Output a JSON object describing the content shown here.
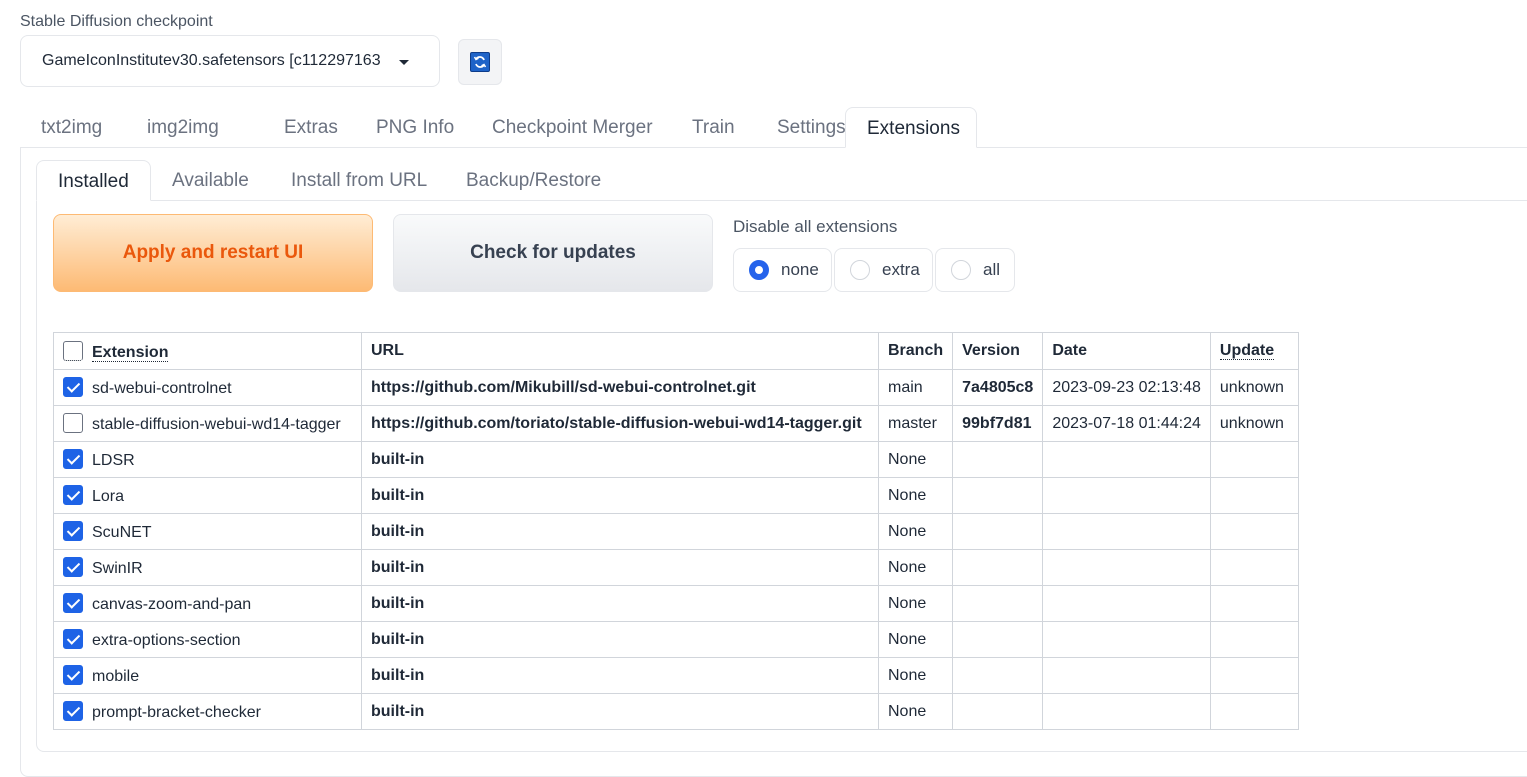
{
  "checkpoint": {
    "label": "Stable Diffusion checkpoint",
    "value": "GameIconInstitutev30.safetensors [c112297163"
  },
  "top_tabs": [
    "txt2img",
    "img2img",
    "Extras",
    "PNG Info",
    "Checkpoint Merger",
    "Train",
    "Settings",
    "Extensions"
  ],
  "top_tab_active": "Extensions",
  "inner_tabs": [
    "Installed",
    "Available",
    "Install from URL",
    "Backup/Restore"
  ],
  "inner_tab_active": "Installed",
  "buttons": {
    "apply": "Apply and restart UI",
    "check": "Check for updates"
  },
  "disable": {
    "label": "Disable all extensions",
    "options": [
      "none",
      "extra",
      "all"
    ],
    "selected": "none"
  },
  "table": {
    "headers": [
      "Extension",
      "URL",
      "Branch",
      "Version",
      "Date",
      "Update"
    ],
    "header_checked": false,
    "rows": [
      {
        "checked": true,
        "name": "sd-webui-controlnet",
        "url": "https://github.com/Mikubill/sd-webui-controlnet.git",
        "branch": "main",
        "version": "7a4805c8",
        "date": "2023-09-23 02:13:48",
        "update": "unknown"
      },
      {
        "checked": false,
        "name": "stable-diffusion-webui-wd14-tagger",
        "url": "https://github.com/toriato/stable-diffusion-webui-wd14-tagger.git",
        "branch": "master",
        "version": "99bf7d81",
        "date": "2023-07-18 01:44:24",
        "update": "unknown"
      },
      {
        "checked": true,
        "name": "LDSR",
        "url": "built-in",
        "branch": "None",
        "version": "",
        "date": "",
        "update": ""
      },
      {
        "checked": true,
        "name": "Lora",
        "url": "built-in",
        "branch": "None",
        "version": "",
        "date": "",
        "update": ""
      },
      {
        "checked": true,
        "name": "ScuNET",
        "url": "built-in",
        "branch": "None",
        "version": "",
        "date": "",
        "update": ""
      },
      {
        "checked": true,
        "name": "SwinIR",
        "url": "built-in",
        "branch": "None",
        "version": "",
        "date": "",
        "update": ""
      },
      {
        "checked": true,
        "name": "canvas-zoom-and-pan",
        "url": "built-in",
        "branch": "None",
        "version": "",
        "date": "",
        "update": ""
      },
      {
        "checked": true,
        "name": "extra-options-section",
        "url": "built-in",
        "branch": "None",
        "version": "",
        "date": "",
        "update": ""
      },
      {
        "checked": true,
        "name": "mobile",
        "url": "built-in",
        "branch": "None",
        "version": "",
        "date": "",
        "update": ""
      },
      {
        "checked": true,
        "name": "prompt-bracket-checker",
        "url": "built-in",
        "branch": "None",
        "version": "",
        "date": "",
        "update": ""
      }
    ]
  }
}
